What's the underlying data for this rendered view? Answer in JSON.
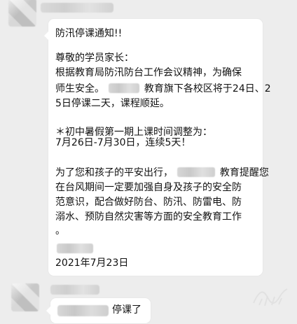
{
  "messages": [
    {
      "lines": [
        "防汛停课通知!!",
        "尊敬的学员家长：",
        " 根据教育局防汛防台工作会议精神，为确保",
        "师生安全。",
        "教育旗下各校区将于24日、2",
        "5日停课二天，课程顺延。",
        "  ＊初中暑假第一期上课时间调整为：",
        " 7月26日-7月30日，连续5天！",
        " 为了您和孩子的平安出行，",
        "教育提醒您",
        "在台风期间一定要加强自身及孩子的安全防",
        "范意识，配合做好防台、防汛、防雷电、防",
        "溺水、预防自然灾害等方面的安全教育工作",
        "。",
        "2021年7月23日"
      ]
    },
    {
      "reply_text": "停课了"
    }
  ],
  "icons": {
    "top_avatar": "avatar-icon",
    "bottom_avatar": "avatar-icon"
  }
}
